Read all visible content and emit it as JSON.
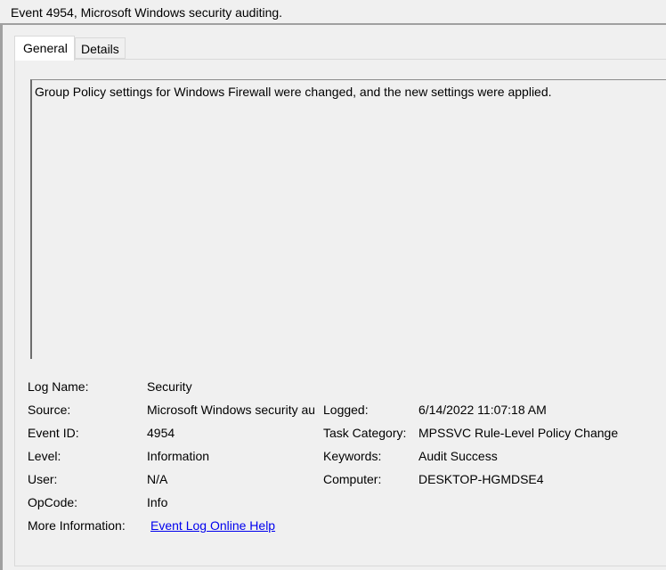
{
  "window": {
    "title": "Event 4954, Microsoft Windows security auditing."
  },
  "tabs": [
    {
      "label": "General",
      "active": true
    },
    {
      "label": "Details",
      "active": false
    }
  ],
  "description": "Group Policy settings for Windows Firewall were changed, and the new settings were applied.",
  "fields": {
    "log_name": {
      "label": "Log Name:",
      "value": "Security"
    },
    "source": {
      "label": "Source:",
      "value": "Microsoft Windows security auditing."
    },
    "event_id": {
      "label": "Event ID:",
      "value": "4954"
    },
    "level": {
      "label": "Level:",
      "value": "Information"
    },
    "user": {
      "label": "User:",
      "value": "N/A"
    },
    "opcode": {
      "label": "OpCode:",
      "value": "Info"
    },
    "more_info": {
      "label": "More Information:",
      "value": "Event Log Online Help"
    },
    "logged": {
      "label": "Logged:",
      "value": "6/14/2022 11:07:18 AM"
    },
    "task_category": {
      "label": "Task Category:",
      "value": "MPSSVC Rule-Level Policy Change"
    },
    "keywords": {
      "label": "Keywords:",
      "value": "Audit Success"
    },
    "computer": {
      "label": "Computer:",
      "value": "DESKTOP-HGMDSE4"
    }
  },
  "colors": {
    "link": "#0000ee",
    "background": "#f0f0f0"
  }
}
